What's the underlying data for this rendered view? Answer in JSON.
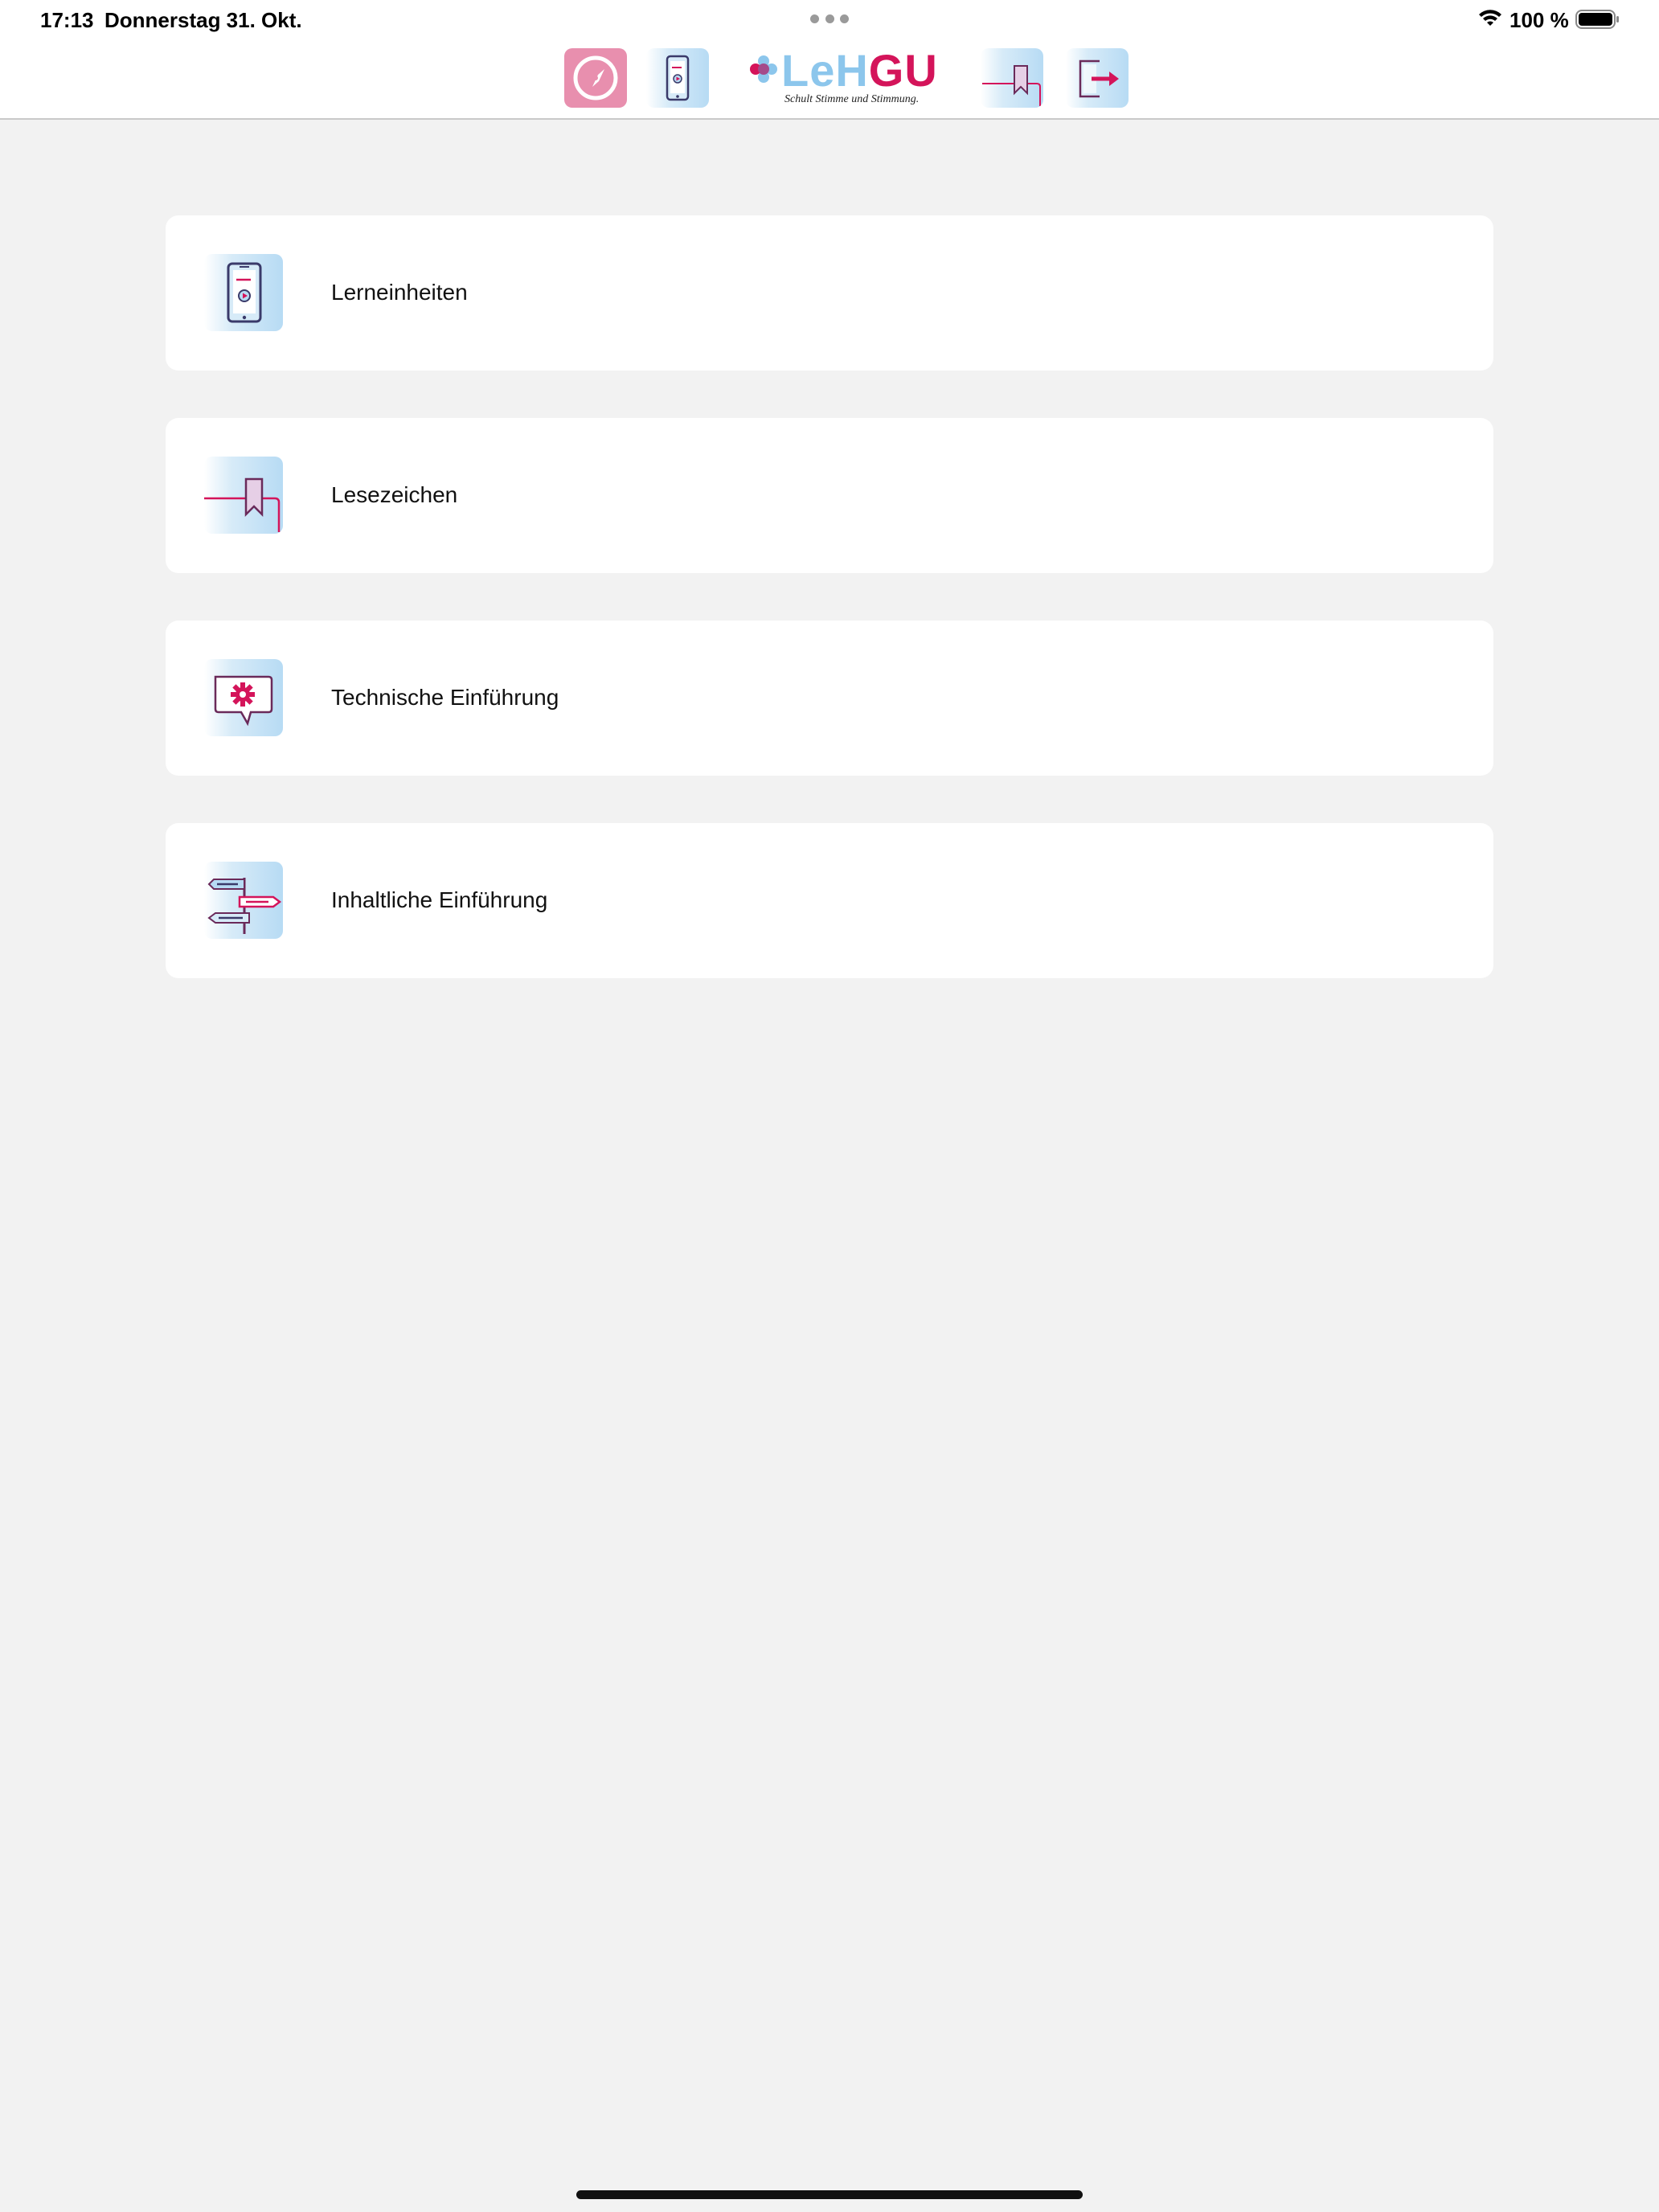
{
  "status_bar": {
    "time": "17:13",
    "date": "Donnerstag 31. Okt.",
    "battery": "100 %",
    "icons": [
      "wifi-icon",
      "battery-icon"
    ]
  },
  "header": {
    "logo": {
      "word_left": "LeH",
      "word_right": "GU",
      "tagline": "Schult Stimme und Stimmung."
    },
    "toolbar": [
      {
        "icon": "compass-icon"
      },
      {
        "icon": "smartphone-video-icon"
      },
      {
        "icon": "bookmark-icon"
      },
      {
        "icon": "logout-icon"
      }
    ]
  },
  "menu": {
    "items": [
      {
        "label": "Lerneinheiten",
        "icon": "smartphone-video-icon"
      },
      {
        "label": "Lesezeichen",
        "icon": "bookmark-icon"
      },
      {
        "label": "Technische Einführung",
        "icon": "gear-speech-bubble-icon"
      },
      {
        "label": "Inhaltliche Einführung",
        "icon": "signpost-icon"
      }
    ]
  },
  "colors": {
    "accent_pink": "#d4145a",
    "accent_blue": "#8cc6ec",
    "compass_bg": "#e88fae",
    "page_bg": "#f2f2f2",
    "card_bg": "#ffffff"
  }
}
